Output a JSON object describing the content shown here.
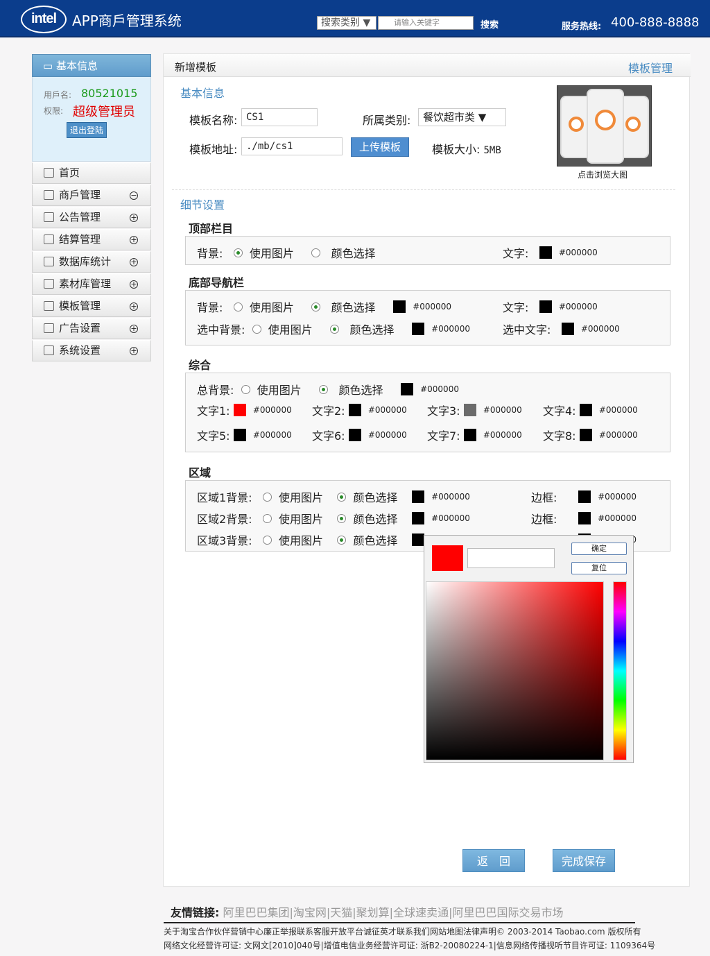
{
  "header": {
    "logo_text": "intel",
    "app_title": "APP商戶管理系统",
    "search_category": "搜索类别 ▼",
    "search_placeholder": "请输入关键字",
    "search_button": "搜索",
    "hotline_label": "服务热线:",
    "hotline_number": "400-888-8888"
  },
  "sidebar": {
    "head": "基本信息",
    "user_label": "用戶名:",
    "user_value": "80521015",
    "role_label": "权限:",
    "role_value": "超级管理员",
    "logout": "退出登陆",
    "items": [
      {
        "label": "首页",
        "toggle": ""
      },
      {
        "label": "商戶管理",
        "toggle": "−"
      },
      {
        "label": "公告管理",
        "toggle": "+"
      },
      {
        "label": "结算管理",
        "toggle": "+"
      },
      {
        "label": "数据库统计",
        "toggle": "+"
      },
      {
        "label": "素材库管理",
        "toggle": "+"
      },
      {
        "label": "模板管理",
        "toggle": "+"
      },
      {
        "label": "广告设置",
        "toggle": "+"
      },
      {
        "label": "系统设置",
        "toggle": "+"
      }
    ]
  },
  "main": {
    "title": "新增模板",
    "breadcrumb": "模板管理",
    "basic_title": "基本信息",
    "name_label": "模板名称:",
    "name_value": "CS1",
    "category_label": "所属类别:",
    "category_value": "餐饮超市类 ▼",
    "address_label": "模板地址:",
    "address_value": "./mb/cs1",
    "upload_btn": "上传模板",
    "size_label": "模板大小:",
    "size_value": "5MB",
    "preview_caption": "点击浏览大图",
    "detail_title": "细节设置",
    "top_bar": {
      "title": "顶部栏目",
      "bg_label": "背景:",
      "opt_image": "使用图片",
      "opt_color": "颜色选择",
      "text_label": "文字:",
      "text_color": "#000000"
    },
    "bottom_nav": {
      "title": "底部导航栏",
      "bg_label": "背景:",
      "opt_image": "使用图片",
      "opt_color": "颜色选择",
      "bg_color": "#000000",
      "text_label": "文字:",
      "text_color": "#000000",
      "sel_bg_label": "选中背景:",
      "sel_bg_color": "#000000",
      "sel_text_label": "选中文字:",
      "sel_text_color": "#000000"
    },
    "general": {
      "title": "综合",
      "total_bg_label": "总背景:",
      "opt_image": "使用图片",
      "opt_color": "颜色选择",
      "total_bg_color": "#000000",
      "texts": [
        {
          "label": "文字1:",
          "hex": "#000000",
          "swatch": "#ff0000"
        },
        {
          "label": "文字2:",
          "hex": "#000000",
          "swatch": "#000000"
        },
        {
          "label": "文字3:",
          "hex": "#000000",
          "swatch": "#6b6b6b"
        },
        {
          "label": "文字4:",
          "hex": "#000000",
          "swatch": "#000000"
        },
        {
          "label": "文字5:",
          "hex": "#000000",
          "swatch": "#000000"
        },
        {
          "label": "文字6:",
          "hex": "#000000",
          "swatch": "#000000"
        },
        {
          "label": "文字7:",
          "hex": "#000000",
          "swatch": "#000000"
        },
        {
          "label": "文字8:",
          "hex": "#000000",
          "swatch": "#000000"
        }
      ]
    },
    "area": {
      "title": "区域",
      "opt_image": "使用图片",
      "opt_color": "颜色选择",
      "border_label": "边框:",
      "rows": [
        {
          "label": "区域1背景:",
          "hex": "#000000",
          "border_hex": "#000000"
        },
        {
          "label": "区域2背景:",
          "hex": "#000000",
          "border_hex": "#000000"
        },
        {
          "label": "区域3背景:",
          "hex": "#000000",
          "border_hex": "#000000"
        }
      ]
    },
    "picker": {
      "ok": "确定",
      "reset": "复位",
      "current_color": "#ff0000"
    },
    "back_btn": "返　回",
    "save_btn": "完成保存"
  },
  "footer": {
    "friends_label": "友情链接:",
    "friends_links": "阿里巴巴集团|淘宝网|天猫|聚划算|全球速卖通|阿里巴巴国际交易市场",
    "line1": "关于淘宝合作伙伴营销中心廉正举报联系客服开放平台诚征英才联系我们网站地图法律声明© 2003-2014 Taobao.com 版权所有",
    "line2": "网络文化经营许可证: 文网文[2010]040号|增值电信业务经营许可证: 浙B2-20080224-1|信息网络传播视听节目许可证: 1109364号"
  }
}
